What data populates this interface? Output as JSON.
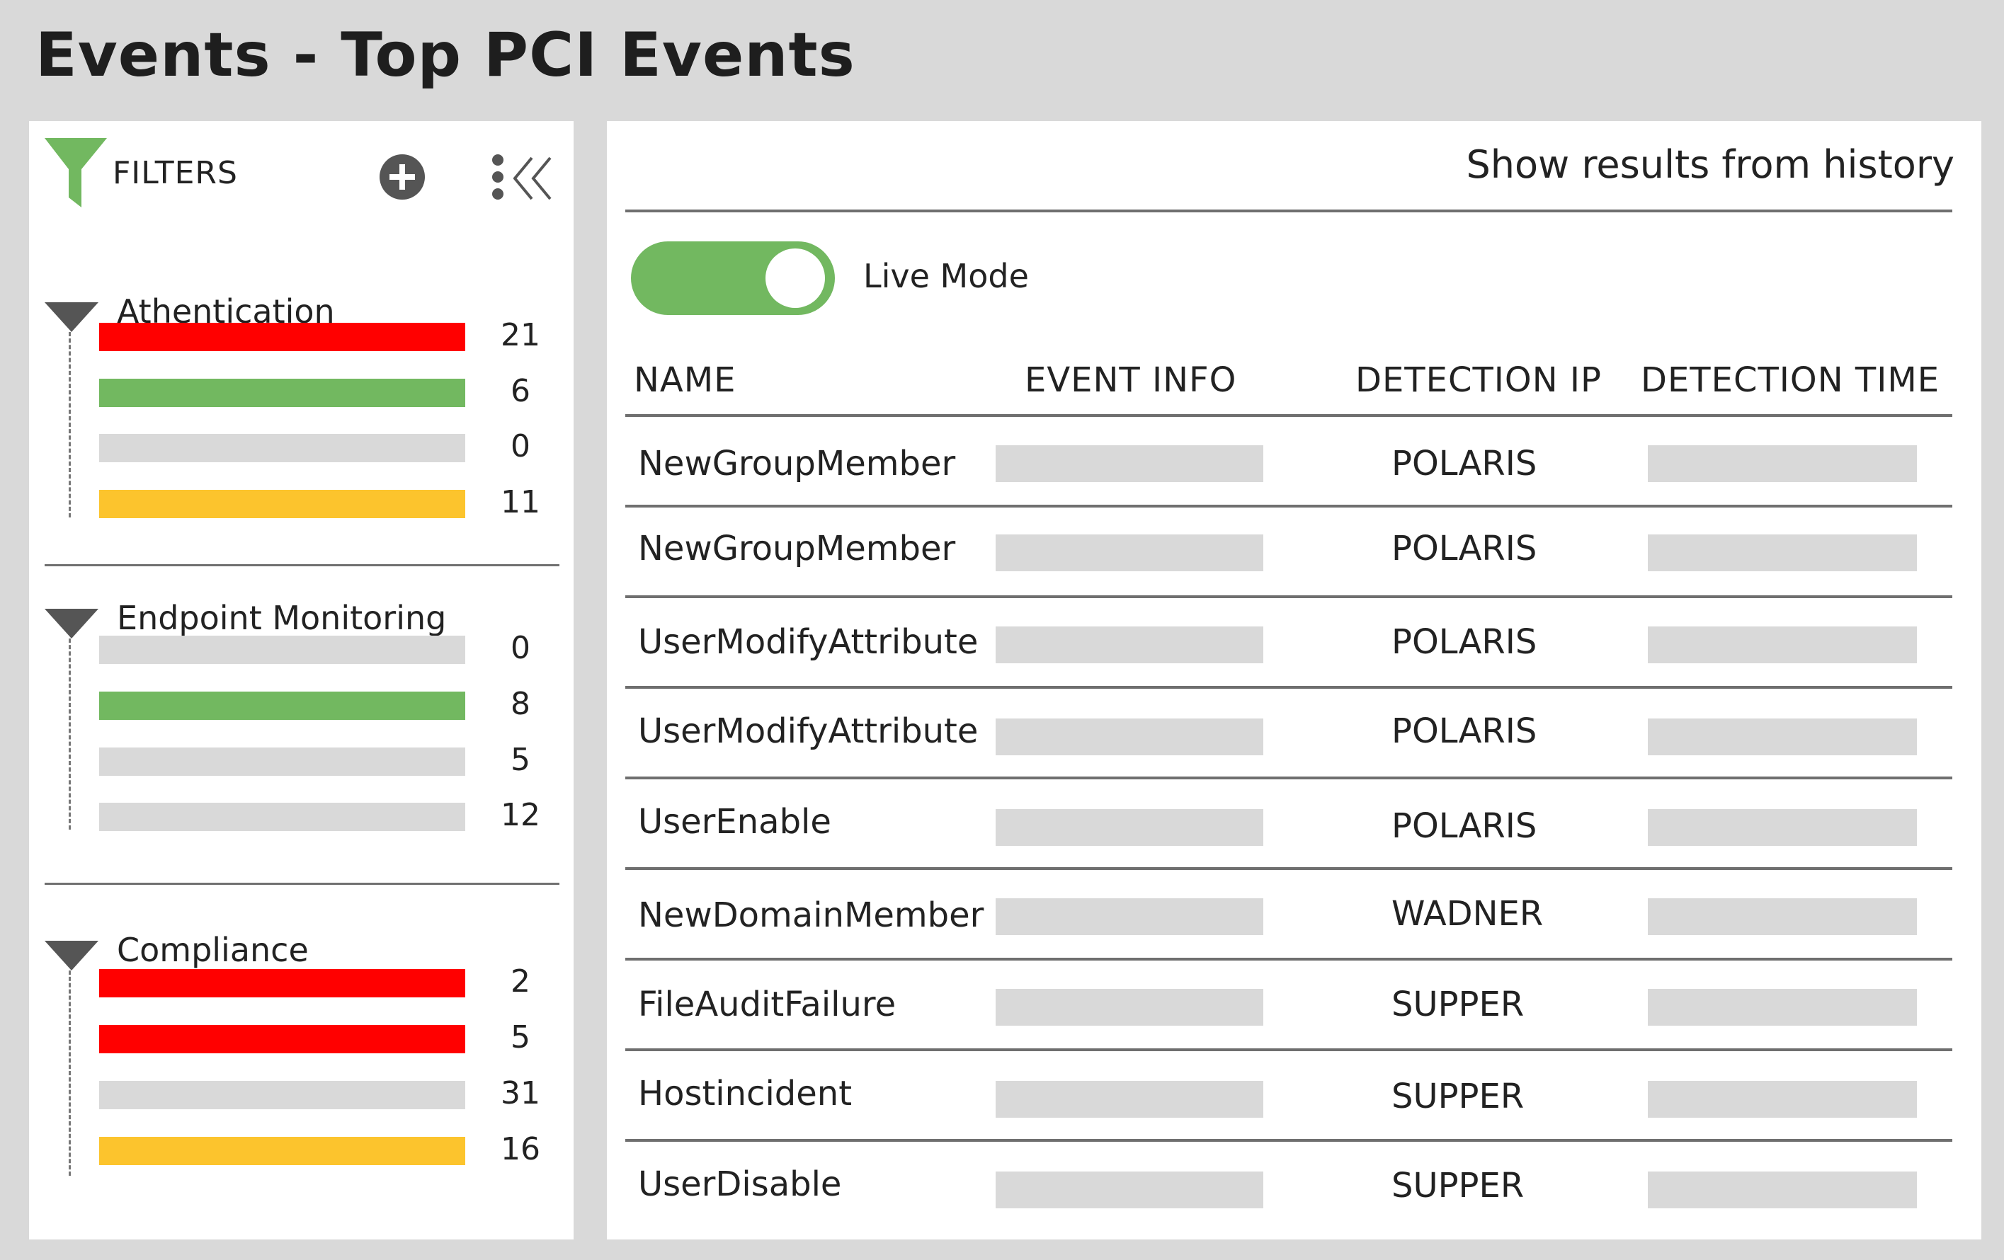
{
  "page": {
    "title": "Events - Top PCI Events"
  },
  "colors": {
    "background": "#d9d9d9",
    "panel": "#ffffff",
    "accent_green": "#72b860",
    "red": "#ff0000",
    "yellow": "#fcc42d",
    "neutral_bar": "#d9d9d9"
  },
  "filters": {
    "label": "FILTERS",
    "icons": [
      "funnel-icon",
      "add-circle-icon",
      "more-vertical-icon",
      "double-chevron-left-icon"
    ],
    "groups": [
      {
        "title": "Athentication",
        "bars": [
          {
            "count": "21",
            "color": "#ff0000"
          },
          {
            "count": "6",
            "color": "#72b860"
          },
          {
            "count": "0",
            "color": "#d9d9d9"
          },
          {
            "count": "11",
            "color": "#fcc42d"
          }
        ]
      },
      {
        "title": "Endpoint Monitoring",
        "bars": [
          {
            "count": "0",
            "color": "#d9d9d9"
          },
          {
            "count": "8",
            "color": "#72b860"
          },
          {
            "count": "5",
            "color": "#d9d9d9"
          },
          {
            "count": "12",
            "color": "#d9d9d9"
          }
        ]
      },
      {
        "title": "Compliance",
        "bars": [
          {
            "count": "2",
            "color": "#ff0000"
          },
          {
            "count": "5",
            "color": "#ff0000"
          },
          {
            "count": "31",
            "color": "#d9d9d9"
          },
          {
            "count": "16",
            "color": "#fcc42d"
          }
        ]
      }
    ]
  },
  "results": {
    "history_link": "Show results from history",
    "live_mode": {
      "label": "Live Mode",
      "on": true
    },
    "columns": [
      "NAME",
      "EVENT INFO",
      "DETECTION IP",
      "DETECTION TIME"
    ],
    "rows": [
      {
        "name": "NewGroupMember",
        "ip": "POLARIS"
      },
      {
        "name": "NewGroupMember",
        "ip": "POLARIS"
      },
      {
        "name": "UserModifyAttribute",
        "ip": "POLARIS"
      },
      {
        "name": "UserModifyAttribute",
        "ip": "POLARIS"
      },
      {
        "name": "UserEnable",
        "ip": "POLARIS"
      },
      {
        "name": "NewDomainMember",
        "ip": "WADNER"
      },
      {
        "name": "FileAuditFailure",
        "ip": "SUPPER"
      },
      {
        "name": "Hostincident",
        "ip": "SUPPER"
      },
      {
        "name": "UserDisable",
        "ip": "SUPPER"
      }
    ]
  }
}
